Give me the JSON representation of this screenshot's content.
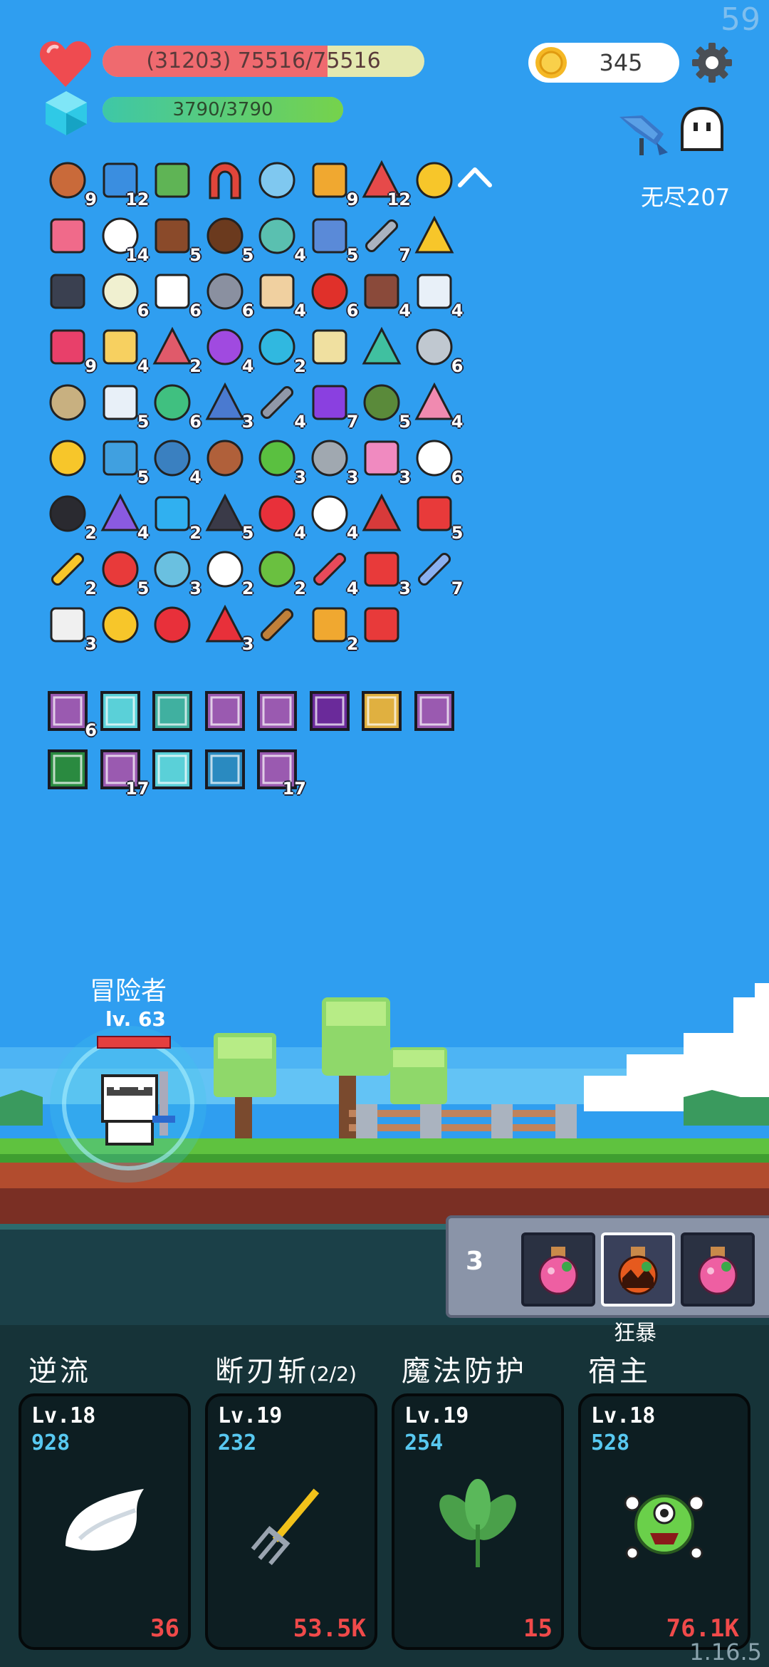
{
  "fps": "59",
  "version": "1.16.5",
  "player": {
    "hp_text": "(31203) 75516/75516",
    "hp_fraction": 0.7,
    "mp_text": "3790/3790",
    "mp_fraction": 1.0
  },
  "currency": {
    "coins": "345"
  },
  "mode_label": "无尽207",
  "items": [
    {
      "icon": "round-shield-icon",
      "count": "9"
    },
    {
      "icon": "star-card-icon",
      "count": "12"
    },
    {
      "icon": "money-heart-icon",
      "count": ""
    },
    {
      "icon": "magnet-icon",
      "count": ""
    },
    {
      "icon": "magnifier-icon",
      "count": ""
    },
    {
      "icon": "book-icon",
      "count": "9"
    },
    {
      "icon": "watermelon-icon",
      "count": "12"
    },
    {
      "icon": "sun-icon",
      "count": ""
    },
    {
      "icon": "heart-photo-icon",
      "count": ""
    },
    {
      "icon": "flower-icon",
      "count": "14"
    },
    {
      "icon": "cake-flag-icon",
      "count": "5"
    },
    {
      "icon": "coconut-icon",
      "count": "5"
    },
    {
      "icon": "disc-icon",
      "count": "4"
    },
    {
      "icon": "halo-mustache-icon",
      "count": "5"
    },
    {
      "icon": "sword-icon",
      "count": "7"
    },
    {
      "icon": "crown-icon",
      "count": ""
    },
    {
      "icon": "skull-book-icon",
      "count": ""
    },
    {
      "icon": "lightbulb-icon",
      "count": "6"
    },
    {
      "icon": "playing-card-icon",
      "count": "6"
    },
    {
      "icon": "spiked-mace-icon",
      "count": "6"
    },
    {
      "icon": "milk-bottle-icon",
      "count": "4"
    },
    {
      "icon": "apple-icon",
      "count": "6"
    },
    {
      "icon": "tombstone-icon",
      "count": "4"
    },
    {
      "icon": "envelope-icon",
      "count": "4"
    },
    {
      "icon": "jam-jar-icon",
      "count": "9"
    },
    {
      "icon": "note-paper-icon",
      "count": "4"
    },
    {
      "icon": "hook-icon",
      "count": "2"
    },
    {
      "icon": "crystal-ball-icon",
      "count": "4"
    },
    {
      "icon": "speech-bubble-icon",
      "count": "2"
    },
    {
      "icon": "treasure-map-icon",
      "count": ""
    },
    {
      "icon": "tent-icon",
      "count": ""
    },
    {
      "icon": "meteor-icon",
      "count": "6"
    },
    {
      "icon": "noose-icon",
      "count": ""
    },
    {
      "icon": "clipboard-icon",
      "count": "5"
    },
    {
      "icon": "green-figure-icon",
      "count": "6"
    },
    {
      "icon": "blue-shield-icon",
      "count": "3"
    },
    {
      "icon": "battle-axe-icon",
      "count": "4"
    },
    {
      "icon": "purple-chest-icon",
      "count": "7"
    },
    {
      "icon": "grenade-icon",
      "count": "5"
    },
    {
      "icon": "ice-cream-icon",
      "count": "4"
    },
    {
      "icon": "sunflower-icon",
      "count": ""
    },
    {
      "icon": "scroll-icon",
      "count": "5"
    },
    {
      "icon": "crosshair-icon",
      "count": "4"
    },
    {
      "icon": "meat-leg-icon",
      "count": ""
    },
    {
      "icon": "zombie-icon",
      "count": "3"
    },
    {
      "icon": "compass-icon",
      "count": "3"
    },
    {
      "icon": "spray-bottle-icon",
      "count": "3"
    },
    {
      "icon": "fried-egg-icon",
      "count": "6"
    },
    {
      "icon": "cauldron-icon",
      "count": "2"
    },
    {
      "icon": "star-shield-icon",
      "count": "4"
    },
    {
      "icon": "blue-gem-icon",
      "count": "2"
    },
    {
      "icon": "bat-icon",
      "count": "5"
    },
    {
      "icon": "red-heart-icon",
      "count": "4"
    },
    {
      "icon": "cloud-icon",
      "count": "4"
    },
    {
      "icon": "crest-shield-icon",
      "count": ""
    },
    {
      "icon": "sock-icon",
      "count": "5"
    },
    {
      "icon": "magic-wand-icon",
      "count": "2"
    },
    {
      "icon": "mushroom-icon",
      "count": "5"
    },
    {
      "icon": "potion-flask-icon",
      "count": "3"
    },
    {
      "icon": "ghost-icon",
      "count": "2"
    },
    {
      "icon": "lime-icon",
      "count": "2"
    },
    {
      "icon": "pill-icon",
      "count": "4"
    },
    {
      "icon": "bookmark-icon",
      "count": "3"
    },
    {
      "icon": "capsule-icon",
      "count": "7"
    },
    {
      "icon": "dice-icon",
      "count": "3"
    },
    {
      "icon": "ring-icon",
      "count": ""
    },
    {
      "icon": "double-heart-icon",
      "count": ""
    },
    {
      "icon": "strawberry-icon",
      "count": "3"
    },
    {
      "icon": "bow-icon",
      "count": ""
    },
    {
      "icon": "paper-scroll-icon",
      "count": "2"
    },
    {
      "icon": "gift-box-icon",
      "count": ""
    }
  ],
  "cards": [
    {
      "icon": "slash-card-icon",
      "count": "6"
    },
    {
      "icon": "light-card-icon",
      "count": ""
    },
    {
      "icon": "robot-card-icon",
      "count": ""
    },
    {
      "icon": "slash-card-icon",
      "count": ""
    },
    {
      "icon": "slash-card-icon",
      "count": ""
    },
    {
      "icon": "demon-card-icon",
      "count": ""
    },
    {
      "icon": "shield-card-icon",
      "count": ""
    },
    {
      "icon": "slash-card-icon",
      "count": ""
    },
    {
      "icon": "rune-card-icon",
      "count": ""
    },
    {
      "icon": "slash-card-icon",
      "count": "17"
    },
    {
      "icon": "light-card-icon",
      "count": ""
    },
    {
      "icon": "vortex-card-icon",
      "count": ""
    },
    {
      "icon": "slash-card-icon",
      "count": "17"
    }
  ],
  "hero": {
    "name": "冒险者",
    "level": "lv. 63"
  },
  "potions": {
    "count": "3",
    "selected_label": "狂暴"
  },
  "skills": [
    {
      "name": "逆流",
      "sub": "",
      "lv": "Lv.18",
      "value": "928",
      "cost": "36",
      "icon": "wing-icon"
    },
    {
      "name": "断刃斩",
      "sub": "(2/2)",
      "lv": "Lv.19",
      "value": "232",
      "cost": "53.5K",
      "icon": "trident-icon"
    },
    {
      "name": "魔法防护",
      "sub": "",
      "lv": "Lv.19",
      "value": "254",
      "cost": "15",
      "icon": "leaf-icon"
    },
    {
      "name": "宿主",
      "sub": "",
      "lv": "Lv.18",
      "value": "528",
      "cost": "76.1K",
      "icon": "eye-monster-icon"
    }
  ]
}
